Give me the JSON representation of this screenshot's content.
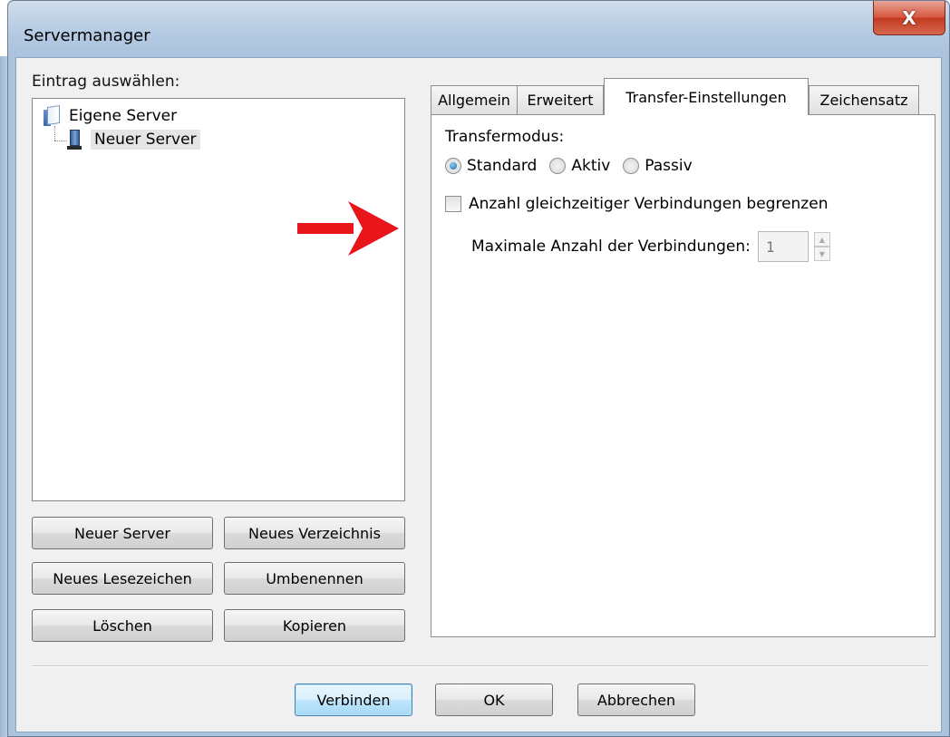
{
  "window": {
    "title": "Servermanager",
    "close_label": "X"
  },
  "left": {
    "select_label": "Eintrag auswählen:",
    "tree": {
      "root": "Eigene Server",
      "child": "Neuer Server"
    },
    "buttons": {
      "new_server": "Neuer Server",
      "new_folder": "Neues Verzeichnis",
      "new_bookmark": "Neues Lesezeichen",
      "rename": "Umbenennen",
      "delete": "Löschen",
      "copy": "Kopieren"
    }
  },
  "tabs": [
    {
      "label": "Allgemein"
    },
    {
      "label": "Erweitert"
    },
    {
      "label": "Transfer-Einstellungen",
      "active": true
    },
    {
      "label": "Zeichensatz"
    }
  ],
  "transfer": {
    "mode_label": "Transfermodus:",
    "modes": [
      "Standard",
      "Aktiv",
      "Passiv"
    ],
    "selected_mode": "Standard",
    "limit_label": "Anzahl gleichzeitiger Verbindungen begrenzen",
    "limit_checked": false,
    "max_label": "Maximale Anzahl der Verbindungen:",
    "max_value": "1"
  },
  "footer": {
    "connect": "Verbinden",
    "ok": "OK",
    "cancel": "Abbrechen"
  },
  "colors": {
    "arrow": "#e8161b",
    "accent": "#3c7fb1"
  }
}
